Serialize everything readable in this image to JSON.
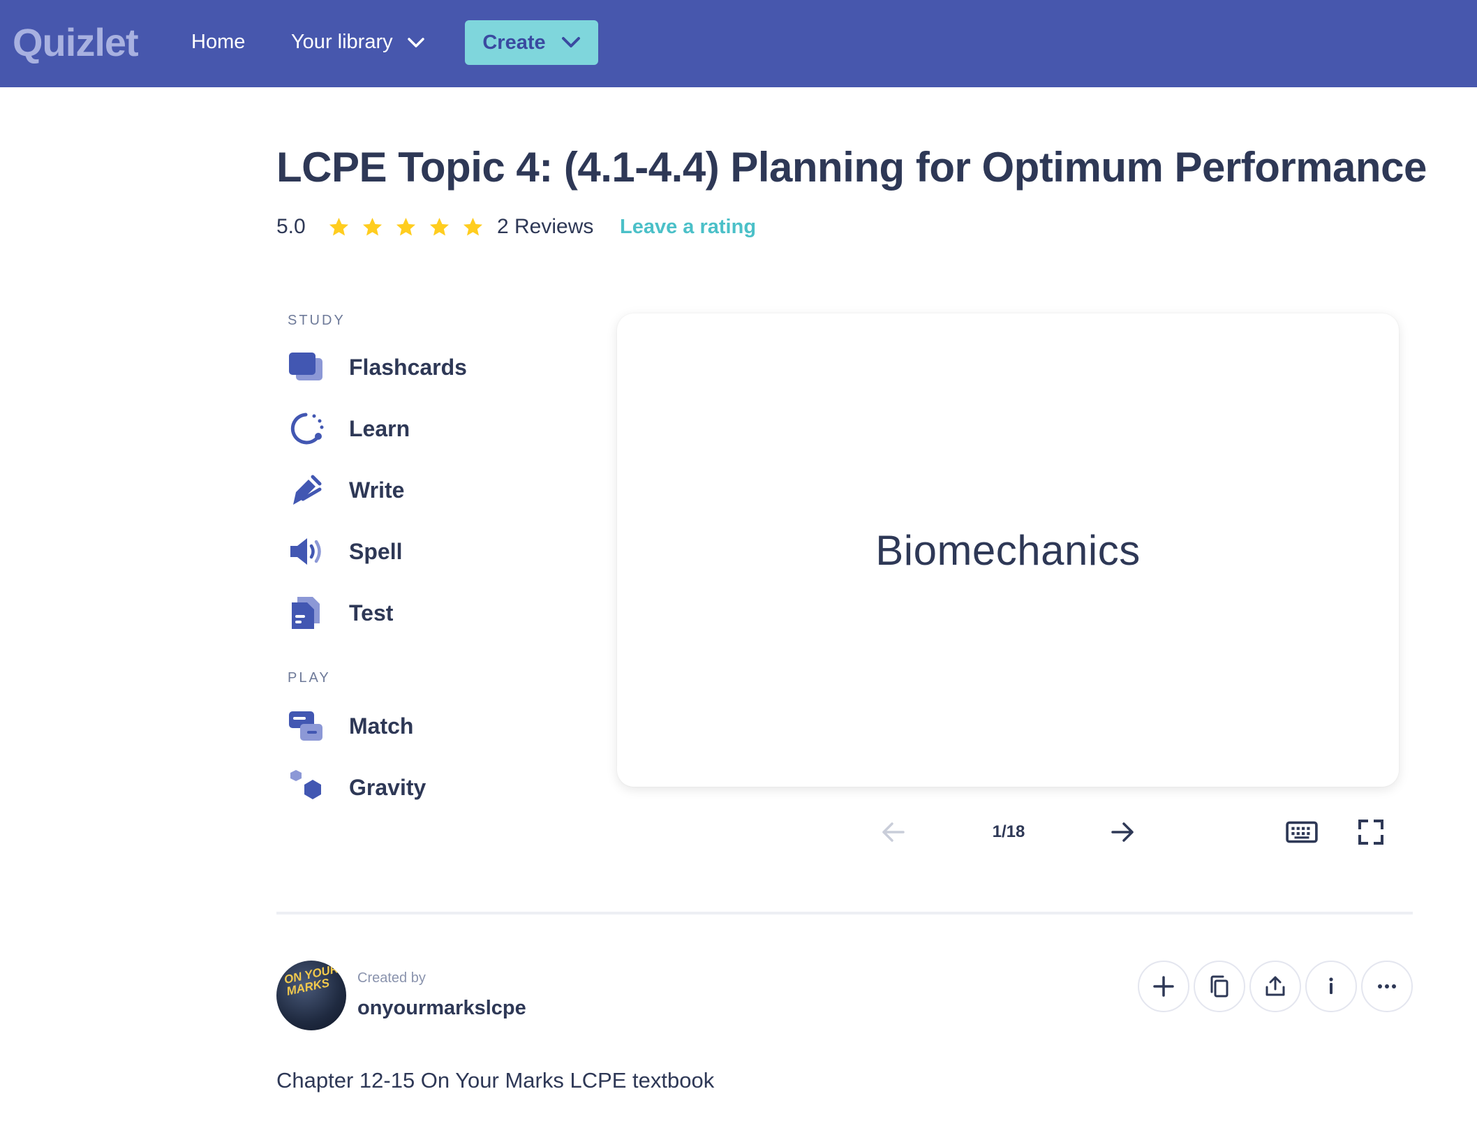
{
  "nav": {
    "logo": "Quizlet",
    "home": "Home",
    "library": "Your library",
    "create": "Create"
  },
  "set": {
    "title": "LCPE Topic 4: (4.1-4.4) Planning for Optimum Performance",
    "rating": "5.0",
    "stars": 5,
    "reviews": "2 Reviews",
    "leave_rating": "Leave a rating"
  },
  "study": {
    "label": "STUDY",
    "modes": [
      {
        "label": "Flashcards",
        "icon": "flashcards-icon"
      },
      {
        "label": "Learn",
        "icon": "learn-icon"
      },
      {
        "label": "Write",
        "icon": "write-icon"
      },
      {
        "label": "Spell",
        "icon": "spell-icon"
      },
      {
        "label": "Test",
        "icon": "test-icon"
      }
    ]
  },
  "play": {
    "label": "PLAY",
    "modes": [
      {
        "label": "Match",
        "icon": "match-icon"
      },
      {
        "label": "Gravity",
        "icon": "gravity-icon"
      }
    ]
  },
  "card": {
    "term": "Biomechanics",
    "counter": "1/18"
  },
  "creator": {
    "created_by": "Created by",
    "name": "onyourmarkslcpe",
    "avatar_text": "ON YOUR MARKS"
  },
  "description": "Chapter 12-15 On Your Marks LCPE textbook",
  "colors": {
    "nav_bg": "#4757ad",
    "create_bg": "#7fd6dc",
    "accent_teal": "#4bc0c8",
    "star": "#ffcd1f",
    "icon_primary": "#4257b2",
    "text": "#2e3856"
  }
}
